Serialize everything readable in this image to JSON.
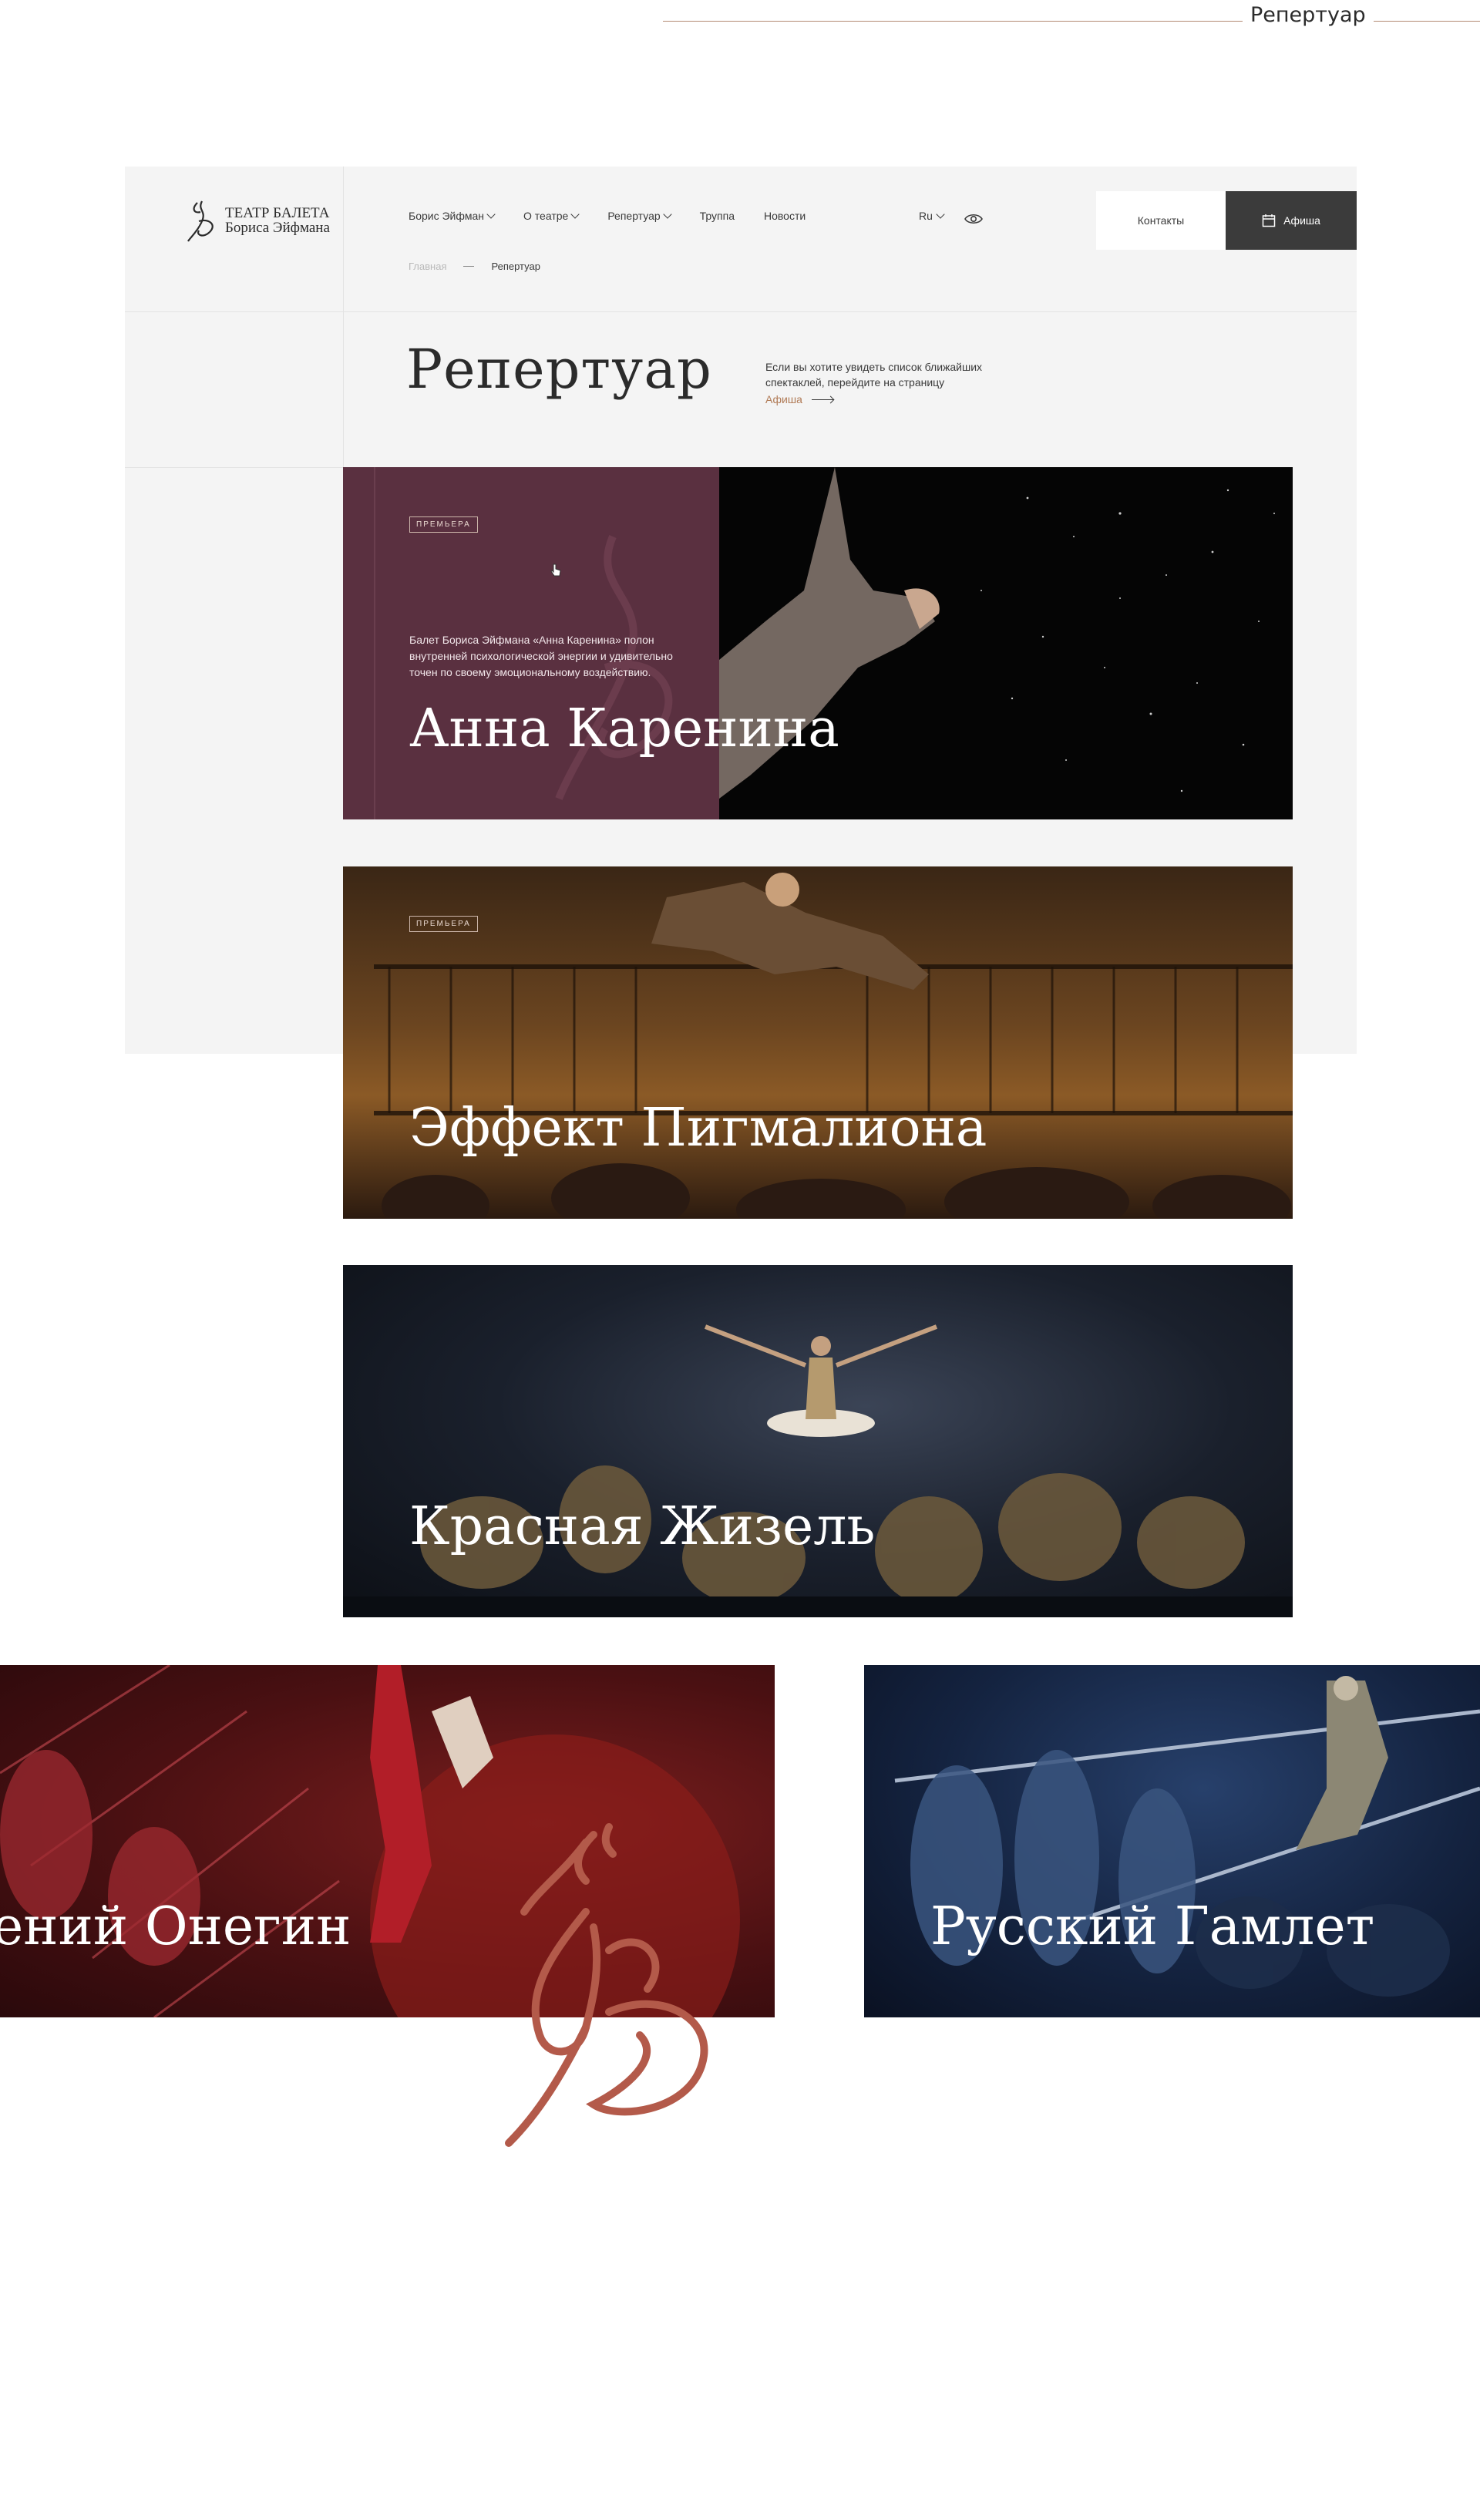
{
  "top_label": "Репертуар",
  "logo": {
    "line1": "ТЕАТР БАЛЕТА",
    "line2": "Бориса Эйфмана"
  },
  "nav": [
    {
      "label": "Борис Эйфман",
      "has_dropdown": true
    },
    {
      "label": "О театре",
      "has_dropdown": true
    },
    {
      "label": "Репертуар",
      "has_dropdown": true
    },
    {
      "label": "Труппа",
      "has_dropdown": false
    },
    {
      "label": "Новости",
      "has_dropdown": false
    }
  ],
  "lang": "Ru",
  "buttons": {
    "contacts": "Контакты",
    "afisha": "Афиша"
  },
  "breadcrumb": {
    "home": "Главная",
    "current": "Репертуар"
  },
  "page_title": "Репертуар",
  "intro": {
    "text": "Если вы хотите увидеть список ближайших спектаклей, перейдите на страницу",
    "link": "Афиша"
  },
  "cards": [
    {
      "title": "Анна Каренина",
      "badge": "ПРЕМЬЕРА",
      "description": "Балет Бориса Эйфмана «Анна Каренина» полон внутренней психологической энергии и удивительно точен по своему эмоциональному воздействию."
    },
    {
      "title": "Эффект Пигмалиона",
      "badge": "ПРЕМЬЕРА"
    },
    {
      "title": "Красная Жизель"
    },
    {
      "title": "ений Онегин"
    },
    {
      "title": "Русский Гамлет"
    }
  ],
  "colors": {
    "accent": "#b07a55",
    "anna_panel": "#5a3040",
    "dark_button": "#3b3b3b",
    "monogram": "#b35a4a"
  }
}
